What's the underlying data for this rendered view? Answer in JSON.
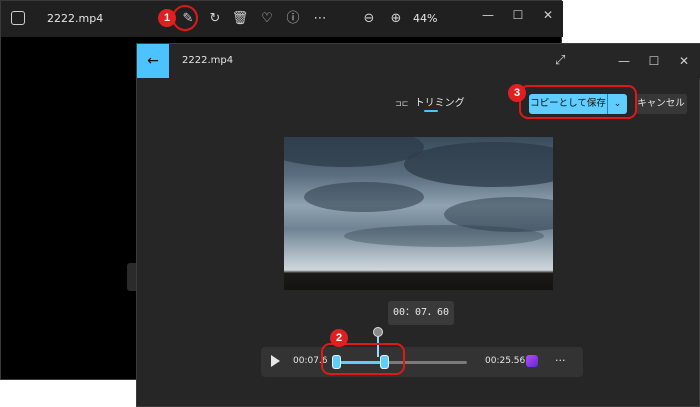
{
  "back_window": {
    "filename": "2222.mp4",
    "zoom": "44%",
    "toolbar": [
      "edit-image-icon",
      "rotate-icon",
      "trash-icon",
      "heart-icon",
      "info-icon",
      "more-icon",
      "zoom-out-icon",
      "zoom-in-icon"
    ],
    "minimize": "—",
    "maximize": "☐",
    "close": "✕"
  },
  "front_window": {
    "filename": "2222.mp4",
    "back_glyph": "←",
    "expand_glyph": "⤢",
    "trim_icon": "⊐⊏",
    "trim_label": "トリミング",
    "save_label": "コピーとして保存",
    "save_dropdown": "⌄",
    "cancel_label": "キャンセル",
    "minimize": "—",
    "maximize": "☐",
    "close": "✕",
    "current_time": "00：07．60",
    "player": {
      "start_time": "00:07.6",
      "end_time": "00:25.56",
      "more": "···"
    }
  },
  "markers": [
    "1",
    "2",
    "3"
  ],
  "colors": {
    "accent": "#60cdff",
    "marker": "#e02020"
  }
}
